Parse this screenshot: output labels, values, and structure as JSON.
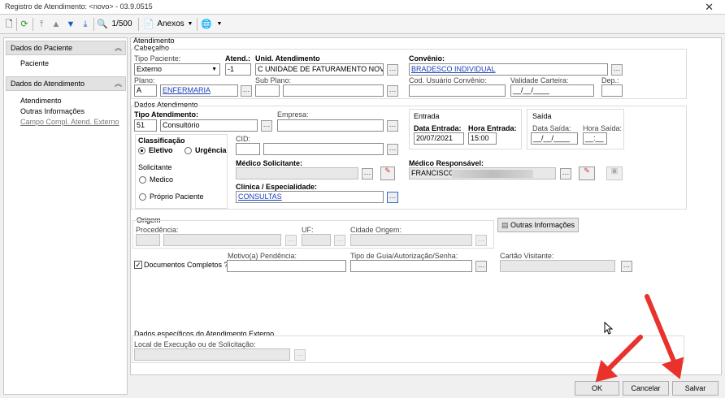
{
  "window": {
    "title": "Registro de Atendimento: <novo> - 03.9.0515"
  },
  "toolbar": {
    "counter": "1/500",
    "anexos": "Anexos"
  },
  "sidebar": {
    "paciente_header": "Dados do Paciente",
    "paciente": "Paciente",
    "atendimento_header": "Dados do Atendimento",
    "atendimento": "Atendimento",
    "outras": "Outras Informações",
    "campo": "Campo Compl. Atend. Externo"
  },
  "form": {
    "section_atendimento": "Atendimento",
    "cabecalho": "Cabeçalho",
    "tipo_paciente_lbl": "Tipo Paciente:",
    "tipo_paciente": "Externo",
    "atend_lbl": "Atend.:",
    "atend": "-1",
    "unid_lbl": "Unid. Atendimento",
    "unid": "C UNIDADE DE FATURAMENTO NOVA C",
    "convenio_lbl": "Convênio:",
    "convenio": "BRADESCO INDIVIDUAL",
    "plano_lbl": "Plano:",
    "plano_code": "A",
    "plano": "ENFERMARIA",
    "subplano_lbl": "Sub Plano:",
    "cod_usuario_lbl": "Cod. Usuário Convênio:",
    "validade_lbl": "Validade Carteira:",
    "validade": "__/__/____",
    "dep_lbl": "Dep.:",
    "dados_atend": "Dados Atendimento",
    "tipo_atend_lbl": "Tipo Atendimento:",
    "tipo_atend_code": "51",
    "tipo_atend": "Consultório",
    "empresa_lbl": "Empresa:",
    "entrada": "Entrada",
    "data_entrada_lbl": "Data Entrada:",
    "data_entrada": "20/07/2021",
    "hora_entrada_lbl": "Hora Entrada:",
    "hora_entrada": "15:00",
    "saida": "Saída",
    "data_saida_lbl": "Data Saída:",
    "data_saida": "__/__/____",
    "hora_saida_lbl": "Hora Saída:",
    "hora_saida": "__:__",
    "classificacao": "Classificação",
    "eletivo": "Eletivo",
    "urgencia": "Urgência",
    "solicitante": "Solicitante",
    "medico": "Medico",
    "proprio": "Próprio Paciente",
    "cid_lbl": "CID:",
    "medico_solic_lbl": "Médico Solicitante:",
    "medico_resp_lbl": "Médico Responsável:",
    "medico_resp": "FRANCISCO",
    "clinica_lbl": "Clínica / Especialidade:",
    "clinica": "CONSULTAS",
    "origem": "Origem",
    "procedencia_lbl": "Procedência:",
    "uf_lbl": "UF:",
    "cidade_lbl": "Cidade Origem:",
    "outras_btn": "Outras Informações",
    "docs_lbl": "Documentos Completos ?",
    "motivo_lbl": "Motivo(a) Pendência:",
    "tipo_guia_lbl": "Tipo de Guia/Autorização/Senha:",
    "cartao_lbl": "Cartão Visitante:",
    "dados_ext": "Dados específicos do Atendimento Externo",
    "local_lbl": "Local de Execução ou de Solicitação:"
  },
  "footer": {
    "ok": "OK",
    "cancelar": "Cancelar",
    "salvar": "Salvar"
  },
  "colors": {
    "link": "#1a3fb8",
    "arrow": "#e8322b"
  }
}
